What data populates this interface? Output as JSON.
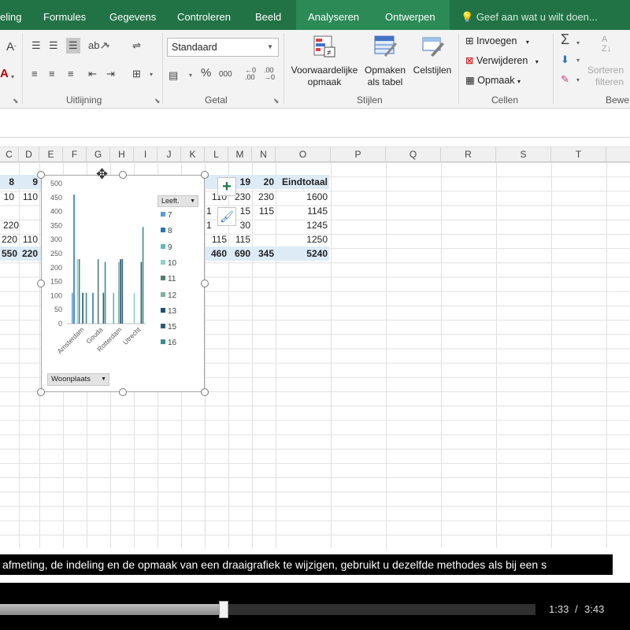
{
  "ribbon_tabs": [
    {
      "label": "eling"
    },
    {
      "label": "Formules"
    },
    {
      "label": "Gegevens"
    },
    {
      "label": "Controleren"
    },
    {
      "label": "Beeld"
    },
    {
      "label": "Analyseren"
    },
    {
      "label": "Ontwerpen"
    }
  ],
  "tell_me": "Geef aan wat u wilt doen...",
  "ribbon": {
    "number_format": "Standaard",
    "groups": {
      "alignment": "Uitlijning",
      "number": "Getal",
      "styles": "Stijlen",
      "cells": "Cellen",
      "editing": "Bewe"
    },
    "conditional_formatting": [
      "Voorwaardelijke",
      "opmaak"
    ],
    "format_as_table": [
      "Opmaken",
      "als tabel"
    ],
    "cell_styles": "Celstijlen",
    "insert": "Invoegen",
    "delete": "Verwijderen",
    "format": "Opmaak",
    "sort_filter": [
      "Sorteren",
      "filteren"
    ],
    "percent": "%",
    "thousands": "000"
  },
  "columns": [
    "C",
    "D",
    "E",
    "F",
    "G",
    "H",
    "I",
    "J",
    "K",
    "L",
    "M",
    "N",
    "O",
    "P",
    "Q",
    "R",
    "S",
    "T"
  ],
  "pivot": {
    "header_left": [
      "8",
      "9"
    ],
    "header_right": [
      "19",
      "20"
    ],
    "grand_total_header": "Eindtotaal",
    "rows": [
      {
        "left": [
          "10",
          "110"
        ],
        "right": [
          "110",
          "230",
          "230"
        ],
        "total": "1600"
      },
      {
        "left": [],
        "right": [
          "1",
          "15",
          "115"
        ],
        "total": "1145"
      },
      {
        "left": [
          "220"
        ],
        "right": [
          "1",
          "30",
          ""
        ],
        "total": "1245"
      },
      {
        "left": [
          "220",
          "110"
        ],
        "right": [
          "115",
          "115",
          ""
        ],
        "total": "1250"
      }
    ],
    "totals_left": [
      "550",
      "220"
    ],
    "totals_right": [
      "460",
      "690",
      "345"
    ],
    "grand_total": "5240"
  },
  "chart_data": {
    "type": "bar",
    "title": "",
    "legend_title": "Leeft.",
    "axis_field": "Woonplaats",
    "categories": [
      "Amsterdam",
      "Gouda",
      "Rotterdam",
      "Utrecht"
    ],
    "ylim": [
      0,
      500
    ],
    "yticks": [
      0,
      50,
      100,
      150,
      200,
      250,
      300,
      350,
      400,
      450,
      500
    ],
    "series": [
      {
        "name": "7",
        "color": "#5b9bd5",
        "values": [
          110,
          0,
          0,
          0
        ]
      },
      {
        "name": "8",
        "color": "#2e75b6",
        "values": [
          460,
          110,
          0,
          0
        ]
      },
      {
        "name": "9",
        "color": "#63b7b7",
        "values": [
          0,
          0,
          110,
          0
        ]
      },
      {
        "name": "10",
        "color": "#8ecfcf",
        "values": [
          230,
          0,
          0,
          110
        ]
      },
      {
        "name": "11",
        "color": "#4e7f6f",
        "values": [
          230,
          230,
          0,
          0
        ]
      },
      {
        "name": "12",
        "color": "#7fb1a0",
        "values": [
          0,
          0,
          220,
          0
        ]
      },
      {
        "name": "13",
        "color": "#1f4e79",
        "values": [
          110,
          0,
          230,
          0
        ]
      },
      {
        "name": "15",
        "color": "#2f5f6f",
        "values": [
          0,
          110,
          230,
          220
        ]
      },
      {
        "name": "16",
        "color": "#3e8c8c",
        "values": [
          110,
          220,
          0,
          345
        ]
      }
    ],
    "grid": false,
    "legend": "right"
  },
  "player": {
    "caption": "afmeting, de indeling en de opmaak van een draaigrafiek te wijzigen, gebruikt u dezelfde methodes als bij een s",
    "current_time": "1:33",
    "separator": "/",
    "duration": "3:43",
    "progress": 0.417
  }
}
